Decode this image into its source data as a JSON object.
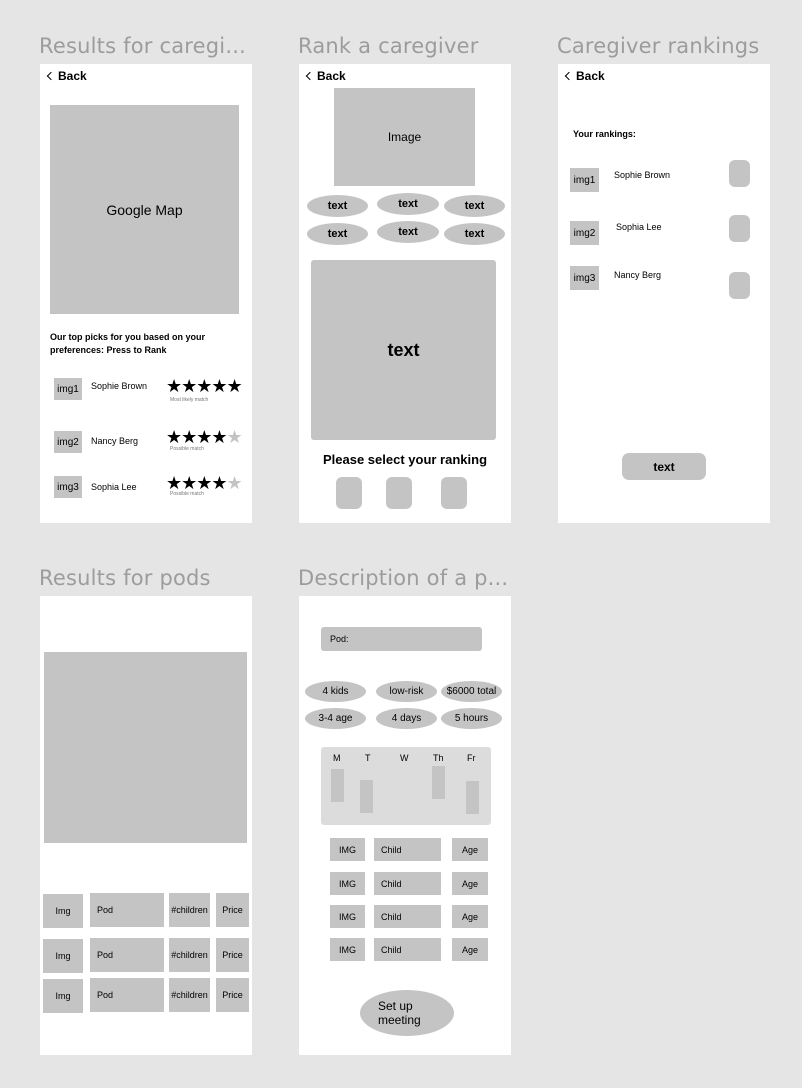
{
  "screens": {
    "results_caregivers": {
      "title": "Results for caregi...",
      "back": "Back",
      "map_label": "Google Map",
      "picks_text": "Our top picks for you based on your preferences: Press to Rank",
      "rows": [
        {
          "img": "img1",
          "name": "Sophie Brown",
          "rating": 5,
          "caption": "Most likely match"
        },
        {
          "img": "img2",
          "name": "Nancy Berg",
          "rating": 4,
          "caption": "Possible match"
        },
        {
          "img": "img3",
          "name": "Sophia Lee",
          "rating": 4,
          "caption": "Possible match"
        }
      ]
    },
    "rank_caregiver": {
      "title": "Rank a caregiver",
      "back": "Back",
      "image_label": "Image",
      "chips": [
        "text",
        "text",
        "text",
        "text",
        "text",
        "text"
      ],
      "panel_text": "text",
      "select_text": "Please select your ranking"
    },
    "caregiver_rankings": {
      "title": "Caregiver rankings",
      "back": "Back",
      "heading": "Your rankings:",
      "rows": [
        {
          "img": "img1",
          "name": "Sophie Brown"
        },
        {
          "img": "img2",
          "name": "Sophia Lee"
        },
        {
          "img": "img3",
          "name": "Nancy Berg"
        }
      ],
      "button": "text"
    },
    "results_pods": {
      "title": "Results for pods",
      "rows": [
        {
          "img": "Img",
          "pod": "Pod",
          "children": "#children",
          "price": "Price"
        },
        {
          "img": "Img",
          "pod": "Pod",
          "children": "#children",
          "price": "Price"
        },
        {
          "img": "Img",
          "pod": "Pod",
          "children": "#children",
          "price": "Price"
        }
      ]
    },
    "pod_description": {
      "title": "Description of a p...",
      "pod_label": "Pod:",
      "chips": [
        "4 kids",
        "low-risk",
        "$6000 total",
        "3-4 age",
        "4 days",
        "5 hours"
      ],
      "days": [
        "M",
        "T",
        "W",
        "Th",
        "Fr"
      ],
      "children": [
        {
          "img": "IMG",
          "child": "Child",
          "age": "Age"
        },
        {
          "img": "IMG",
          "child": "Child",
          "age": "Age"
        },
        {
          "img": "IMG",
          "child": "Child",
          "age": "Age"
        },
        {
          "img": "IMG",
          "child": "Child",
          "age": "Age"
        }
      ],
      "button": "Set up meeting"
    }
  }
}
